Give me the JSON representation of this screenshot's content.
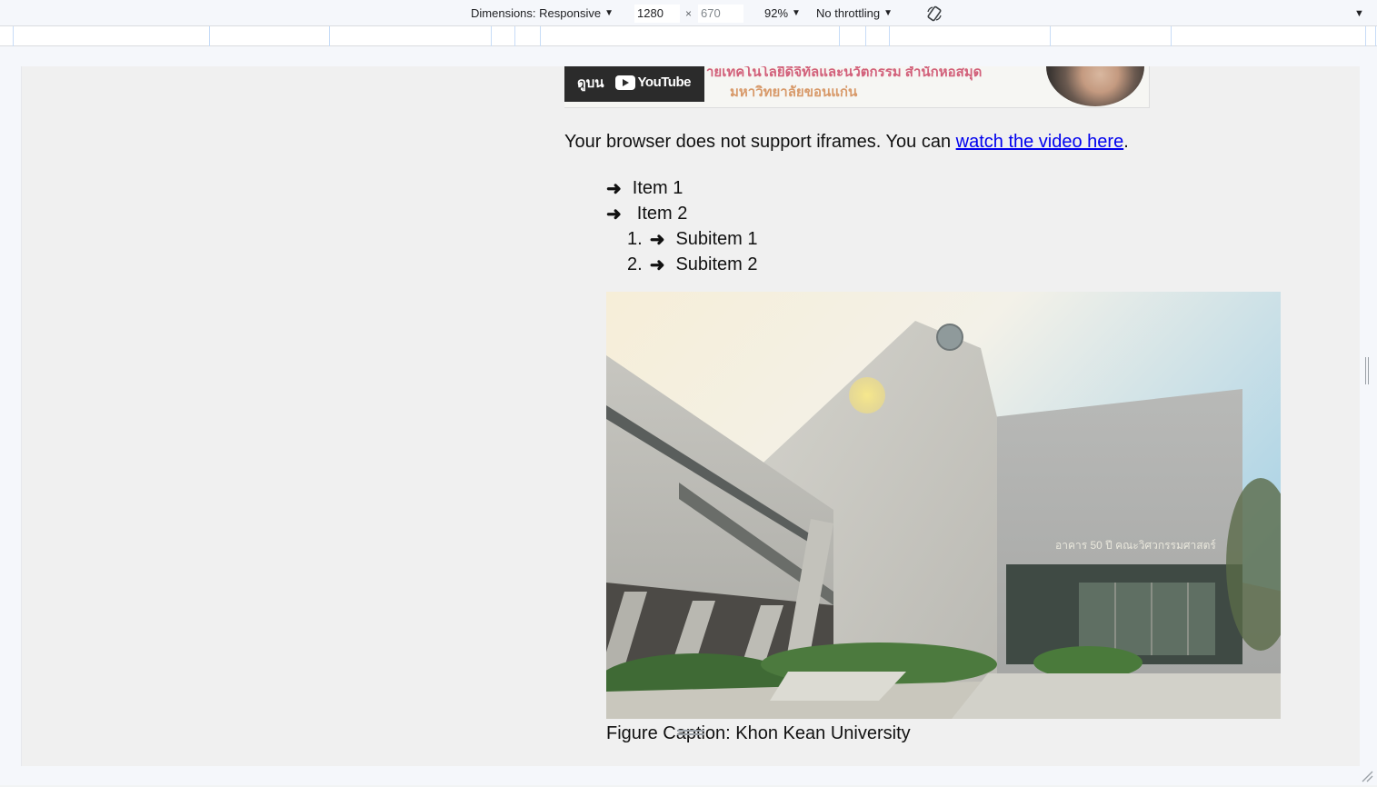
{
  "devtools": {
    "dimensions_label": "Dimensions: Responsive",
    "width_value": "1280",
    "times": "×",
    "height_placeholder": "670",
    "zoom": "92%",
    "throttling": "No throttling"
  },
  "page": {
    "video_banner": {
      "watch_on": "ดูบน",
      "youtube": "YouTube",
      "title_line1": "ายเทคโนโลยีดิจิทัลและนวัตกรรม สำนักหอสมุด",
      "title_line2": "มหาวิทยาลัยขอนแก่น"
    },
    "iframe_message": "Your browser does not support iframes. You can ",
    "iframe_link": "watch the video here",
    "iframe_period": ".",
    "list": {
      "arrow": "➜",
      "item1": "Item 1",
      "item2": "Item 2",
      "sub1_num": "1.",
      "sub1": "Subitem 1",
      "sub2_num": "2.",
      "sub2": "Subitem 2"
    },
    "figure": {
      "building_sign": "อาคาร 50 ปี คณะวิศวกรรมศาสตร์",
      "caption": "Figure Caption: Khon Kean University"
    }
  }
}
